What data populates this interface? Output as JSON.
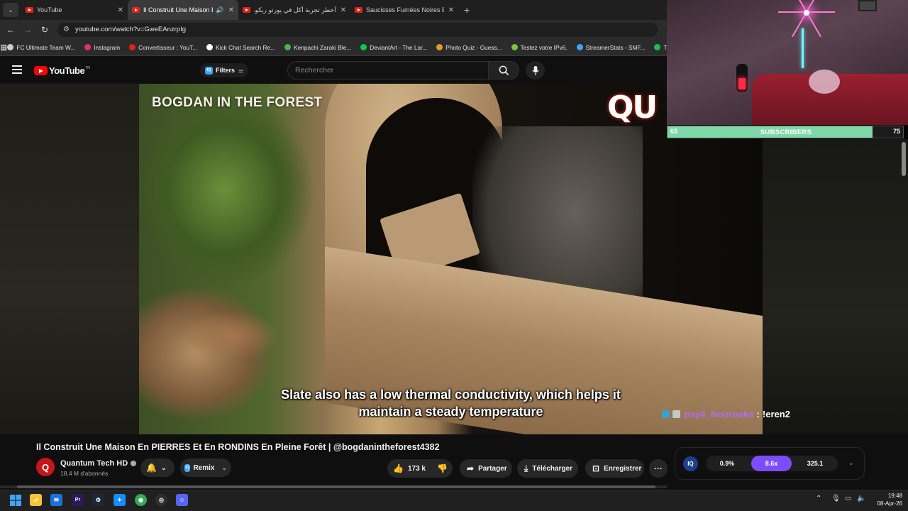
{
  "browser": {
    "tabs": [
      {
        "title": "YouTube",
        "active": false
      },
      {
        "title": "Il Construit Une Maison En PIERRES Et En RONDINS",
        "active": true
      },
      {
        "title": "أخطر تجربة أكل في يورتو ريكو...",
        "active": false
      },
      {
        "title": "Saucisses Fumées Noires Bushcraft",
        "active": false
      }
    ],
    "url": "youtube.com/watch?v=GweEAnzrpIg",
    "bookmarks": [
      {
        "label": "FC Ultimate Team W...",
        "color": "#cfcfcf"
      },
      {
        "label": "Instagram",
        "color": "#e1306c"
      },
      {
        "label": "Convertisseur : YouT...",
        "color": "#e62117"
      },
      {
        "label": "Kick Chat Search Re...",
        "color": "#ffffff"
      },
      {
        "label": "Kenpachi Zaraki Ble...",
        "color": "#4caf50"
      },
      {
        "label": "DeviantArt - The Lar...",
        "color": "#05cc47"
      },
      {
        "label": "Photo Quiz - Guess...",
        "color": "#e39b2a"
      },
      {
        "label": "Testez votre IPv6.",
        "color": "#7cc242"
      },
      {
        "label": "StreamerStats - SMF...",
        "color": "#3ea6ff"
      },
      {
        "label": "Tell It",
        "color": "#1db954"
      }
    ]
  },
  "masthead": {
    "logo_text": "YouTube",
    "logo_sup": "TN",
    "filters_label": "Filters",
    "filters_badge": "IQ",
    "search_placeholder": "Rechercher"
  },
  "video": {
    "watermark": "BOGDAN IN THE FOREST",
    "corner_logo": "QU",
    "caption_line1": "Slate also has a low thermal conductivity, which helps it",
    "caption_line2": "maintain a steady temperature"
  },
  "stream_overlay": {
    "sub_goal": {
      "current": "65",
      "label": "SUBSCRIBERS",
      "target": "75",
      "progress": 0.87,
      "color": "#7fd8a8"
    },
    "chat": {
      "username": "psy4_Nourouka",
      "separator": ":",
      "message": "!eren2"
    }
  },
  "watch": {
    "title": "Il Construit Une Maison En PIERRES Et En RONDINS En Pleine Forêt | @bogdanintheforest4382",
    "channel": {
      "avatar_text": "Q",
      "name": "Quantum Tech HD",
      "subscribers": "18,4 M d'abonnés"
    },
    "remix_label": "Remix",
    "remix_badge": "IQ",
    "likes": "173 k",
    "share_label": "Partager",
    "download_label": "Télécharger",
    "save_label": "Enregistrer",
    "extension": {
      "logo": "IQ",
      "values": [
        "0.9%",
        "8.6x",
        "325.1"
      ],
      "highlight_color": "#7c4dff"
    }
  },
  "taskbar": {
    "apps": [
      {
        "name": "start",
        "color": "#3ea6ff"
      },
      {
        "name": "file-explorer",
        "color": "#f3c33b"
      },
      {
        "name": "outlook",
        "color": "#1a73d8"
      },
      {
        "name": "premiere-pro",
        "color": "#2a1a5c"
      },
      {
        "name": "steam",
        "color": "#1b2838"
      },
      {
        "name": "battle-net",
        "color": "#148eff"
      },
      {
        "name": "chrome",
        "color": "#34a853"
      },
      {
        "name": "obs",
        "color": "#302e31"
      },
      {
        "name": "discord",
        "color": "#5865f2"
      }
    ],
    "time": "19:48",
    "date": "08-Apr-26"
  }
}
